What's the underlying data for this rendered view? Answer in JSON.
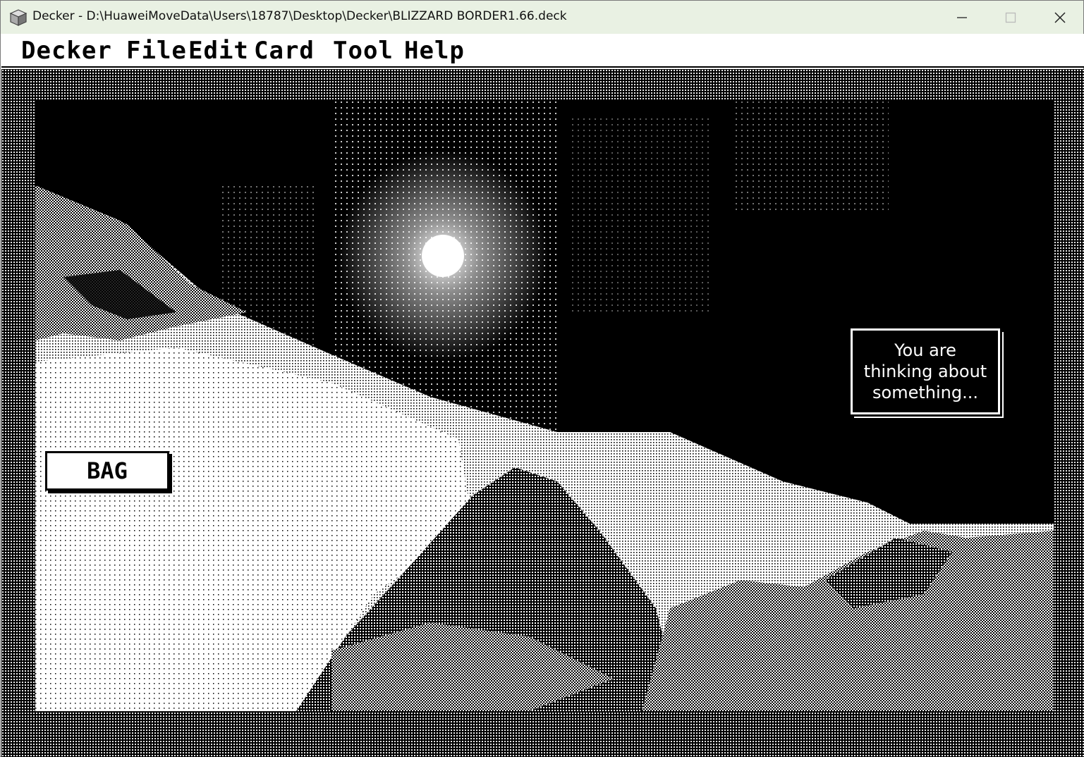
{
  "window": {
    "title": "Decker - D:\\HuaweiMoveData\\Users\\18787\\Desktop\\Decker\\BLIZZARD BORDER1.66.deck",
    "app_icon": "cube-app-icon",
    "controls": {
      "minimize": "minimize-icon",
      "maximize": "maximize-icon",
      "close": "close-icon"
    }
  },
  "menubar": {
    "items": [
      {
        "label": "Decker"
      },
      {
        "label": "File"
      },
      {
        "label": "Edit"
      },
      {
        "label": "Card"
      },
      {
        "label": "Tool"
      },
      {
        "label": "Help"
      }
    ]
  },
  "card": {
    "bag_button": {
      "label": "BAG"
    },
    "thought": {
      "text": "You are\nthinking about\nsomething..."
    }
  },
  "colors": {
    "ink": "#000000",
    "paper": "#ffffff",
    "titlebar": "#e9f1e3"
  }
}
